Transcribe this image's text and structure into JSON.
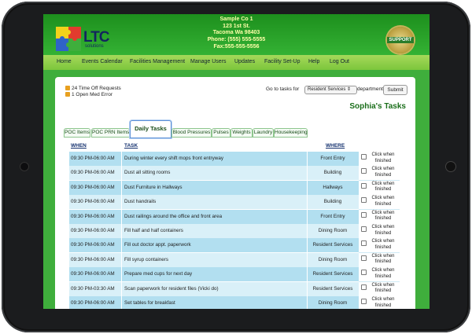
{
  "header": {
    "logo_text": "LTC",
    "logo_sub": "solutions",
    "address_lines": [
      "Sample Co 1",
      "123 1st St.",
      "Tacoma Wa 98403",
      "Phone: (555) 555-5555",
      "Fax:555-555-5556"
    ],
    "support_label": "SUPPORT"
  },
  "nav": [
    "Home",
    "Events Calendar",
    "Facilities Management",
    "Manage Users",
    "Updates",
    "Facility Set-Up",
    "Help",
    "Log Out"
  ],
  "alerts": [
    "24 Time Off Requests",
    "1 Open Med Error"
  ],
  "goto": {
    "label": "Go to tasks for",
    "department": "Resident Services",
    "suffix": "department.",
    "submit": "Submit"
  },
  "page_title": "Sophia's Tasks",
  "tabs": [
    "POC Items",
    "POC PRN Items",
    "Daily Tasks",
    "Blood Pressures",
    "Pulses",
    "Weights",
    "Laundry",
    "Housekeeping"
  ],
  "active_tab": "Daily Tasks",
  "table": {
    "headers": {
      "when": "WHEN",
      "task": "TASK",
      "where": "WHERE"
    },
    "checkbox_label": "Click when finished",
    "rows": [
      {
        "when": "09:30 PM-06:00 AM",
        "task": "During winter every shift mops front entryway",
        "where": "Front Entry"
      },
      {
        "when": "09:30 PM-06:00 AM",
        "task": "Dust all sitting rooms",
        "where": "Building"
      },
      {
        "when": "09:30 PM-06:00 AM",
        "task": "Dust Furniture in Hallways",
        "where": "Hallways"
      },
      {
        "when": "09:30 PM-06:00 AM",
        "task": "Dust handrails",
        "where": "Building"
      },
      {
        "when": "09:30 PM-06:00 AM",
        "task": "Dust railings around the office and front area",
        "where": "Front Entry"
      },
      {
        "when": "09:30 PM-06:00 AM",
        "task": "Fill half and half containers",
        "where": "Dining Room"
      },
      {
        "when": "09:30 PM-06:00 AM",
        "task": "Fill out doctor appt. paperwork",
        "where": "Resident Services"
      },
      {
        "when": "09:30 PM-06:00 AM",
        "task": "Fill syrup containers",
        "where": "Dining Room"
      },
      {
        "when": "09:30 PM-06:00 AM",
        "task": "Prepare med cups for next day",
        "where": "Resident Services"
      },
      {
        "when": "09:30 PM-03:30 AM",
        "task": "Scan paperwork for resident files (Vicki do)",
        "where": "Resident Services"
      },
      {
        "when": "09:30 PM-06:00 AM",
        "task": "Set tables for breakfast",
        "where": "Dining Room"
      }
    ]
  }
}
